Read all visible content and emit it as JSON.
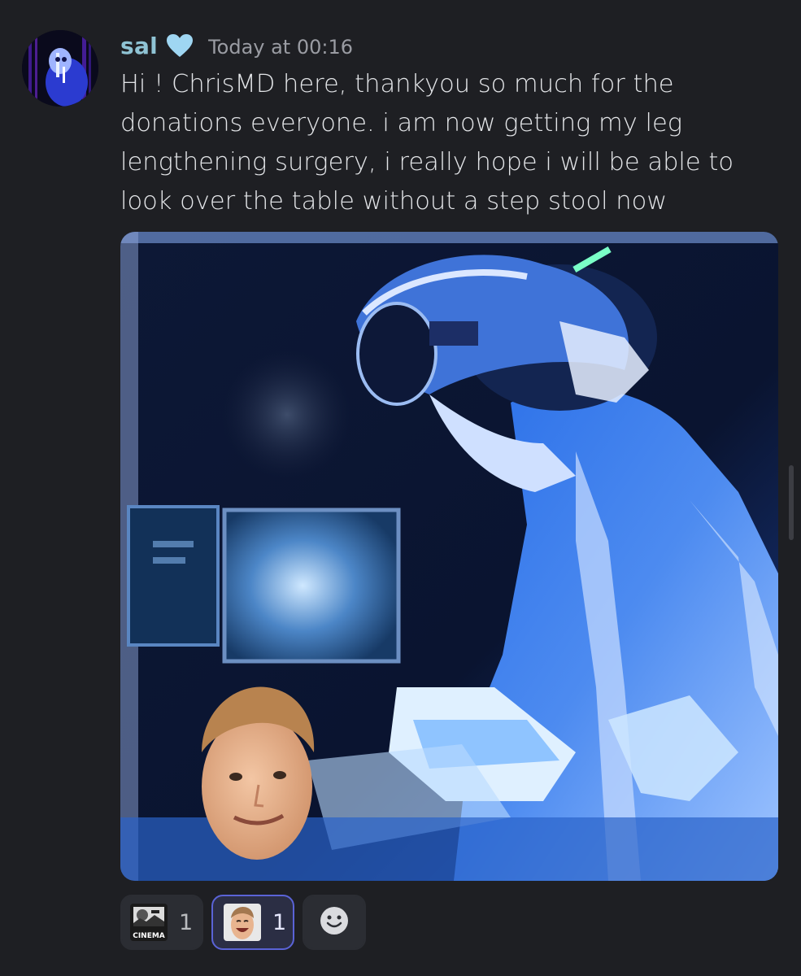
{
  "message": {
    "username": "sal",
    "timestamp": "Today at 00:16",
    "text": "Hi ! ChrisMD here, thankyou so much for the donations everyone. i am now getting my leg lengthening surgery, i really hope i will be able to look over the table without a step stool now",
    "badge_icon": "heart-icon",
    "username_color": "#8fc3d4",
    "badge_color": "#9fd6f2"
  },
  "reactions": [
    {
      "emoji_name": "absolute-cinema-emoji",
      "emoji_text": "CINEMA",
      "count": "1",
      "selected": false
    },
    {
      "emoji_name": "laughing-face-emoji",
      "count": "1",
      "selected": true
    },
    {
      "emoji_name": "add-reaction-icon"
    }
  ],
  "colors": {
    "background": "#1e1f23",
    "reaction_bg": "#2b2d33",
    "reaction_selected_border": "#5a63d6"
  }
}
